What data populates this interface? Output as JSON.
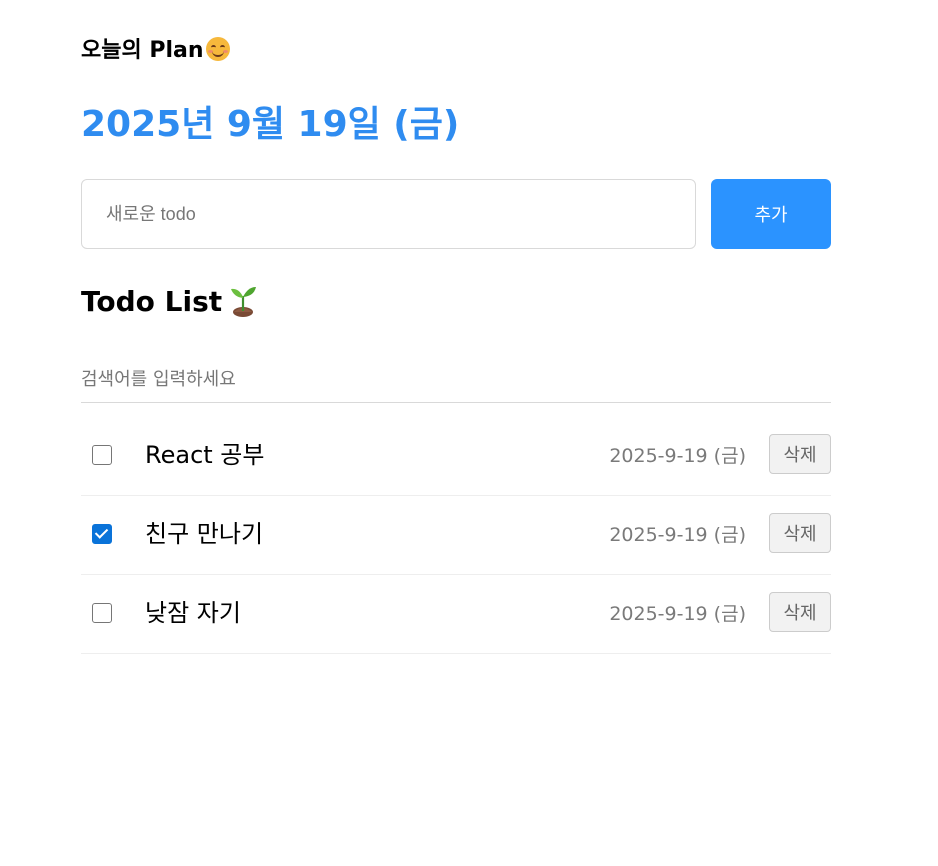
{
  "header": {
    "title": "오늘의 Plan",
    "title_emoji_icon": "smiling-face-icon"
  },
  "date": {
    "text": "2025년 9월 19일 (금)",
    "color": "#2f8cf0"
  },
  "new_todo": {
    "placeholder": "새로운 todo",
    "value": "",
    "add_label": "추가",
    "accent": "#2b93ff"
  },
  "todo_list": {
    "title": "Todo List",
    "title_icon": "seedling-icon",
    "search_placeholder": "검색어를 입력하세요",
    "items": [
      {
        "text": "React 공부",
        "checked": false,
        "date": "2025-9-19 (금)",
        "delete_label": "삭제"
      },
      {
        "text": "친구 만나기",
        "checked": true,
        "date": "2025-9-19 (금)",
        "delete_label": "삭제"
      },
      {
        "text": "낮잠 자기",
        "checked": false,
        "date": "2025-9-19 (금)",
        "delete_label": "삭제"
      }
    ]
  }
}
